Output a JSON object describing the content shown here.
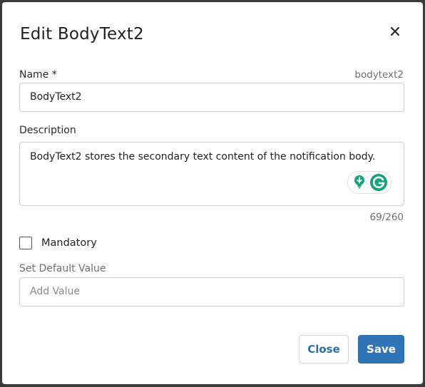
{
  "dialog": {
    "title": "Edit BodyText2",
    "close_icon": "close-icon"
  },
  "name_field": {
    "label": "Name *",
    "key_hint": "bodytext2",
    "value": "BodyText2"
  },
  "description_field": {
    "label": "Description",
    "value": "BodyText2 stores the secondary text content of the notification body.",
    "counter": "69/260",
    "assistant_icons": [
      "lightbulb-icon",
      "grammarly-icon"
    ]
  },
  "mandatory": {
    "label": "Mandatory",
    "checked": false
  },
  "default_value": {
    "label": "Set Default Value",
    "placeholder": "Add Value"
  },
  "actions": {
    "close_label": "Close",
    "save_label": "Save"
  },
  "colors": {
    "primary": "#2f75b5",
    "link": "#2f6fa8",
    "grammarly_green": "#15a37a"
  }
}
